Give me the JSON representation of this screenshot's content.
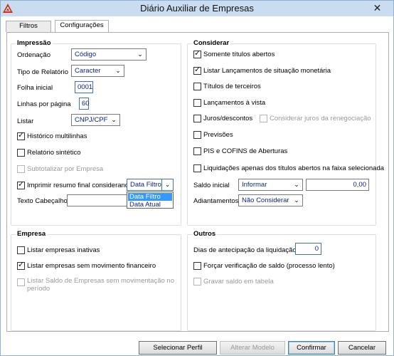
{
  "window": {
    "title": "Diário Auxiliar de Empresas",
    "close_glyph": "✕"
  },
  "tabs": [
    {
      "label": "Filtros",
      "active": false
    },
    {
      "label": "Configurações",
      "active": true
    }
  ],
  "impressao": {
    "title": "Impressão",
    "ordenacao": {
      "label": "Ordenação",
      "value": "Código"
    },
    "tipo_relatorio": {
      "label": "Tipo de Relatório",
      "value": "Caracter"
    },
    "folha_inicial": {
      "label": "Folha inicial",
      "value": "0001"
    },
    "linhas_por_pagina": {
      "label": "Linhas por página",
      "value": "60"
    },
    "listar": {
      "label": "Listar",
      "value": "CNPJ/CPF"
    },
    "historico_multilinhas": {
      "label": "Histórico multilinhas",
      "checked": true
    },
    "relatorio_sintetico": {
      "label": "Relatório sintético",
      "checked": false
    },
    "subtotalizar_empresa": {
      "label": "Subtotalizar por Empresa",
      "checked": false,
      "disabled": true
    },
    "imprimir_resumo": {
      "label": "Imprimir resumo final considerando",
      "checked": true,
      "value": "Data Filtro",
      "options": [
        "Data Filtro",
        "Data Atual"
      ]
    },
    "texto_cabecalho": {
      "label": "Texto Cabeçalho",
      "value": ""
    }
  },
  "considerar": {
    "title": "Considerar",
    "somente_titulos_abertos": {
      "label": "Somente títulos abertos",
      "checked": true
    },
    "listar_lancamentos_monetaria": {
      "label": "Listar Lançamentos de situação monetária",
      "checked": true
    },
    "titulos_terceiros": {
      "label": "Títulos de terceiros",
      "checked": false
    },
    "lancamentos_vista": {
      "label": "Lançamentos à vista",
      "checked": false
    },
    "juros_descontos": {
      "label": "Juros/descontos",
      "checked": false
    },
    "considerar_juros_renegociacao": {
      "label": "Considerar juros da renegociação",
      "checked": false,
      "disabled": true
    },
    "previsoes": {
      "label": "Previsões",
      "checked": false
    },
    "pis_cofins": {
      "label": "PIS e COFINS de Aberturas",
      "checked": false
    },
    "liquidacoes": {
      "label": "Liquidações apenas dos títulos abertos na faixa selecionada",
      "checked": false
    },
    "saldo_inicial": {
      "label": "Saldo inicial",
      "value": "Informar",
      "amount": "0,00"
    },
    "adiantamentos": {
      "label": "Adiantamentos",
      "value": "Não Considerar"
    }
  },
  "empresa": {
    "title": "Empresa",
    "listar_inativas": {
      "label": "Listar empresas inativas",
      "checked": false
    },
    "listar_sem_movimento": {
      "label": "Listar empresas sem movimento financeiro",
      "checked": true
    },
    "listar_saldo_sem_movimentacao": {
      "label_line1": "Listar Saldo de Empresas sem movimentação no",
      "label_line2": "período",
      "checked": false,
      "disabled": true
    }
  },
  "outros": {
    "title": "Outros",
    "dias_antecipacao": {
      "label": "Dias de antecipação da liquidação",
      "value": "0"
    },
    "forcar_verificacao": {
      "label": "Forçar verificação de saldo (processo lento)",
      "checked": false
    },
    "gravar_saldo": {
      "label": "Gravar saldo em tabela",
      "checked": false,
      "disabled": true
    }
  },
  "buttons": {
    "selecionar_perfil": "Selecionar Perfil",
    "alterar_modelo": "Alterar Modelo",
    "confirmar": "Confirmar",
    "cancelar": "Cancelar"
  }
}
